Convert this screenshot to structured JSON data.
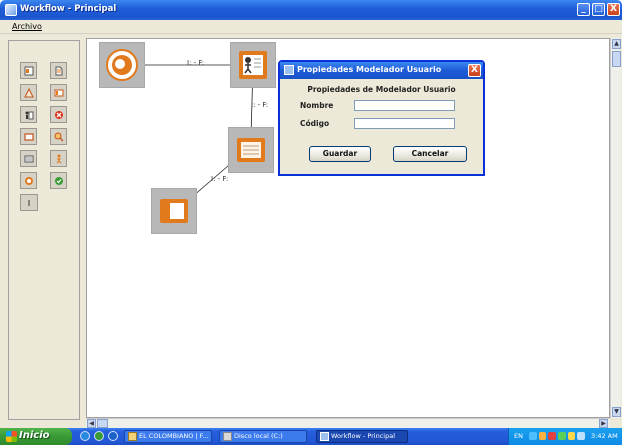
{
  "window": {
    "title": "Workflow - Principal",
    "min_label": "_",
    "max_label": "□",
    "close_label": "X"
  },
  "menubar": {
    "items": [
      {
        "label": "Archivo"
      }
    ]
  },
  "palette": {
    "tools": [
      {
        "name": "task-icon"
      },
      {
        "name": "document-icon"
      },
      {
        "name": "triangle-icon"
      },
      {
        "name": "window-icon"
      },
      {
        "name": "user-group-icon"
      },
      {
        "name": "stop-icon"
      },
      {
        "name": "rectangle-icon"
      },
      {
        "name": "search-icon"
      },
      {
        "name": "form-icon"
      },
      {
        "name": "actor-icon"
      },
      {
        "name": "start-icon"
      },
      {
        "name": "approve-icon"
      },
      {
        "name": "info-icon"
      }
    ]
  },
  "canvas": {
    "connection_label": "I: - F:",
    "nodes": [
      {
        "name": "start-node-icon"
      },
      {
        "name": "user-node-icon"
      },
      {
        "name": "document-node-icon"
      },
      {
        "name": "book-node-icon"
      }
    ]
  },
  "dialog": {
    "title": "Propiedades Modelador Usuario",
    "heading": "Propiedades de Modelador Usuario",
    "close_label": "X",
    "fields": {
      "nombre_label": "Nombre",
      "nombre_value": "",
      "codigo_label": "Código",
      "codigo_value": ""
    },
    "buttons": {
      "save": "Guardar",
      "cancel": "Cancelar"
    }
  },
  "taskbar": {
    "start_label": "Inicio",
    "tasks": [
      {
        "label": "EL COLOMBIANO | F..."
      },
      {
        "label": "Disco local (C:)"
      },
      {
        "label": "Workflow - Principal"
      }
    ],
    "language": "EN",
    "clock": "3:42 AM"
  },
  "colors": {
    "titlebar": "#1f5fd8",
    "window_bg": "#ece9d8",
    "node_bg": "#b8b8b8",
    "node_accent": "#e07a1c",
    "start_button": "#3a9a35"
  }
}
